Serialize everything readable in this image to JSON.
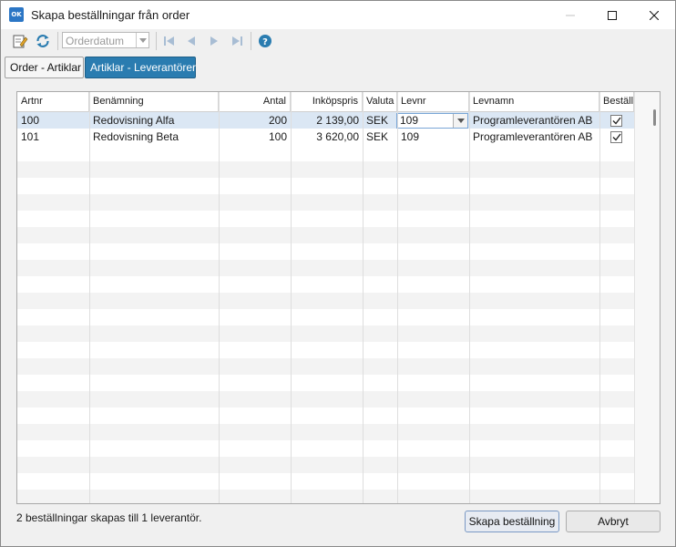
{
  "window": {
    "title": "Skapa beställningar från order",
    "icon": "app-logo-icon",
    "icon_text": "OK"
  },
  "toolbar": {
    "date_select_placeholder": "Orderdatum",
    "icons": [
      "edit-icon",
      "refresh-icon",
      "first-record-icon",
      "previous-record-icon",
      "next-record-icon",
      "last-record-icon",
      "help-icon"
    ]
  },
  "tabs": [
    {
      "label": "Order - Artiklar",
      "active": false
    },
    {
      "label": "Artiklar - Leverantörer",
      "active": true
    }
  ],
  "grid": {
    "columns": [
      "Artnr",
      "Benämning",
      "Antal",
      "Inköpspris",
      "Valuta",
      "Levnr",
      "Levnamn",
      "Beställ"
    ],
    "rows": [
      {
        "artnr": "100",
        "benamning": "Redovisning Alfa",
        "antal": "200",
        "inkopspris": "2 139,00",
        "valuta": "SEK",
        "levnr": "109",
        "levnamn": "Programleverantören AB",
        "bestall": true
      },
      {
        "artnr": "101",
        "benamning": "Redovisning Beta",
        "antal": "100",
        "inkopspris": "3 620,00",
        "valuta": "SEK",
        "levnr": "109",
        "levnamn": "Programleverantören AB",
        "bestall": true
      }
    ]
  },
  "footer": {
    "status": "2 beställningar skapas till 1 leverantör.",
    "create_label": "Skapa beställning",
    "cancel_label": "Avbryt"
  },
  "colors": {
    "accent": "#2a7cb0",
    "selected_row": "#dbe7f4"
  }
}
